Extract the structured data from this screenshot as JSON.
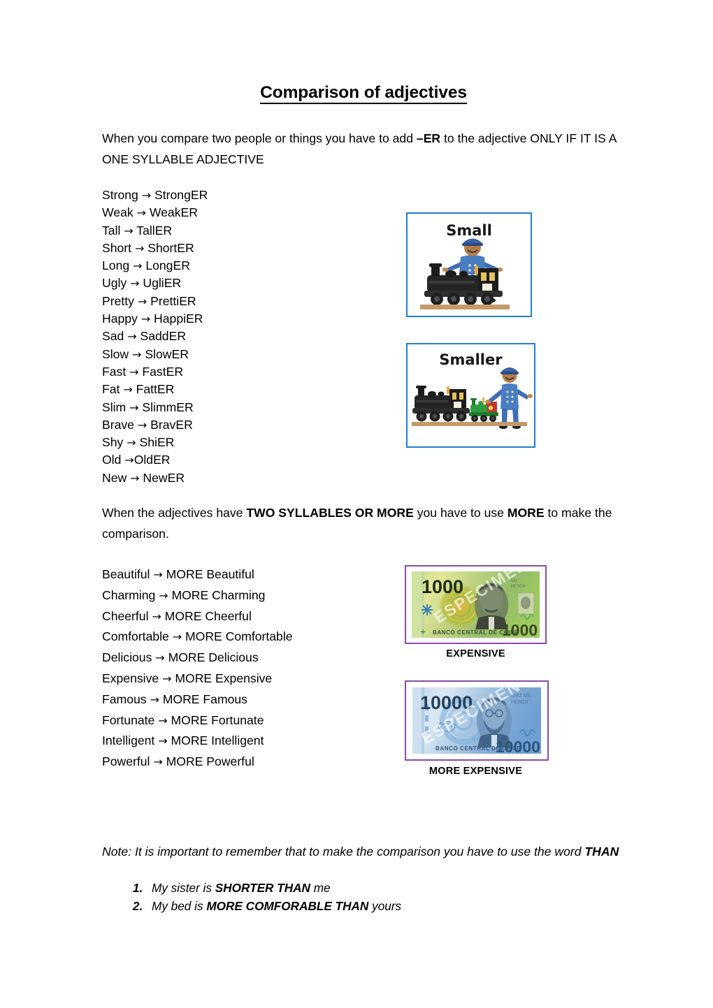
{
  "document": {
    "title": "Comparison of adjectives",
    "intro_paragraph": {
      "part1": "When you compare two people or things you have to add ",
      "bold1": "–ER",
      "part2": " to the adjective ONLY IF IT IS A ONE SYLLABLE ADJECTIVE"
    },
    "one_syllable_list": [
      "Strong → StrongER",
      "Weak → WeakER",
      "Tall → TallER",
      "Short → ShortER",
      "Long → LongER",
      "Ugly → UgliER",
      "Pretty → PrettiER",
      "Happy → HappiER",
      "Sad → SaddER",
      "Slow → SlowER",
      "Fast → FastER",
      "Fat → FattER",
      "Slim → SlimmER",
      "Brave → BravER",
      "Shy → ShiER",
      "Old →OldER",
      "New → NewER"
    ],
    "two_syllable_paragraph": {
      "part1": "When the adjectives have ",
      "bold1": "TWO SYLLABLES OR MORE",
      "part2": " you have to use ",
      "bold2": "MORE",
      "part3": " to make the comparison."
    },
    "more_list": [
      "Beautiful → MORE Beautiful",
      "Charming → MORE Charming",
      "Cheerful → MORE Cheerful",
      "Comfortable → MORE Comfortable",
      "Delicious → MORE Delicious",
      "Expensive → MORE Expensive",
      "Famous → MORE Famous",
      "Fortunate → MORE Fortunate",
      "Intelligent → MORE Intelligent",
      "Powerful → MORE Powerful"
    ],
    "note": {
      "prefix": "Note:  It is important to remember that to make the comparison you have to use the word ",
      "bold": "THAN"
    },
    "examples": [
      {
        "plain1": "My sister is ",
        "bold": "SHORTER THAN",
        "plain2": " me"
      },
      {
        "plain1": "My bed is ",
        "bold": "MORE COMFORABLE THAN",
        "plain2": " yours"
      }
    ]
  },
  "images": {
    "train_small": {
      "label": "Small",
      "border_color": "#1f7fd0",
      "alt": "small-train-with-large-conductor"
    },
    "train_smaller": {
      "label": "Smaller",
      "border_color": "#1f7fd0",
      "alt": "smaller-train-next-to-big-train-and-conductor"
    },
    "banknote_1000": {
      "caption": "EXPENSIVE",
      "border_color": "#8b4aab",
      "denomination": "1000",
      "bank_text": "BANCO CENTRAL DE CHILE",
      "specimen_text": "ESPECIMEN",
      "alt": "chilean-1000-peso-banknote"
    },
    "banknote_10000": {
      "caption": "MORE EXPENSIVE",
      "border_color": "#8b4aab",
      "denomination": "10000",
      "bank_text": "BANCO CENTRAL DE CHILE",
      "specimen_text": "ESPECIMEN",
      "value_text": "DIEZ MIL PESOS",
      "alt": "chilean-10000-peso-banknote"
    }
  }
}
